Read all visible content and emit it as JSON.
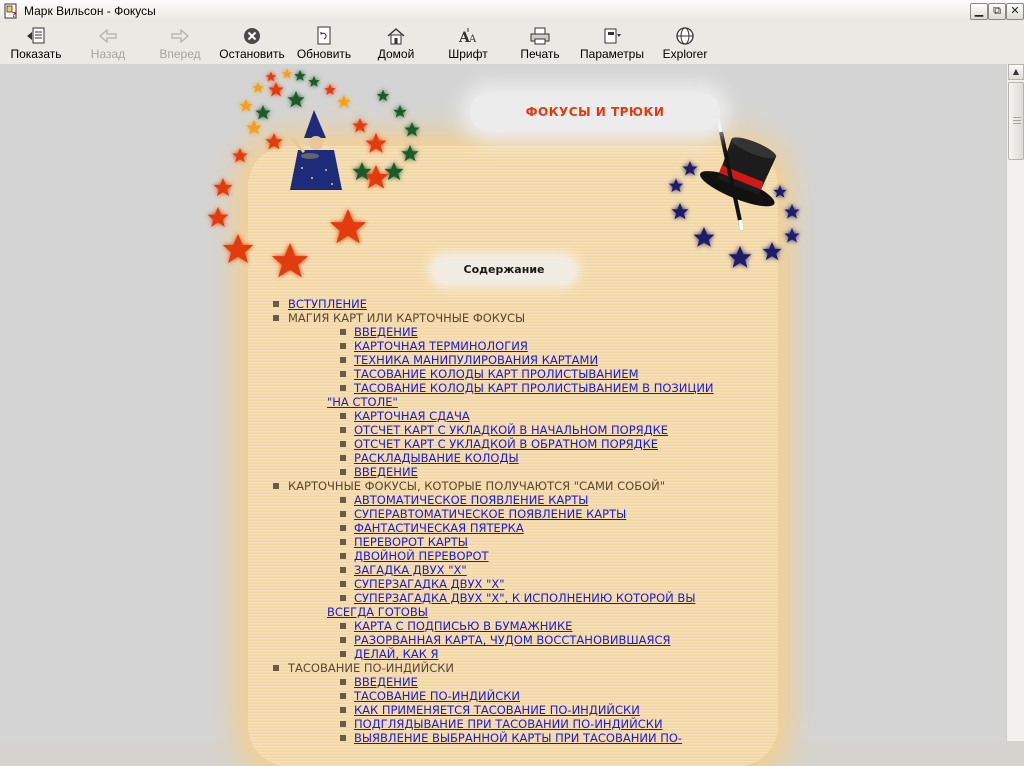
{
  "window": {
    "title": "Марк Вильсон - Фокусы"
  },
  "toolbar": {
    "buttons": [
      {
        "label": "Показать",
        "icon": "show-pane-icon",
        "enabled": true
      },
      {
        "label": "Назад",
        "icon": "back-arrow-icon",
        "enabled": false
      },
      {
        "label": "Вперед",
        "icon": "forward-arrow-icon",
        "enabled": false
      },
      {
        "label": "Остановить",
        "icon": "stop-icon",
        "enabled": true
      },
      {
        "label": "Обновить",
        "icon": "refresh-icon",
        "enabled": true
      },
      {
        "label": "Домой",
        "icon": "home-icon",
        "enabled": true
      },
      {
        "label": "Шрифт",
        "icon": "font-icon",
        "enabled": true
      },
      {
        "label": "Печать",
        "icon": "print-icon",
        "enabled": true
      },
      {
        "label": "Параметры",
        "icon": "options-icon",
        "enabled": true
      },
      {
        "label": "Explorer",
        "icon": "explorer-icon",
        "enabled": true
      }
    ]
  },
  "page": {
    "heading": "ФОКУСЫ И ТРЮКИ",
    "toc_title": "Содержание",
    "accent_color": "#e23a0f",
    "link_color": "#1a1ad0",
    "toc": [
      {
        "level": 1,
        "type": "link",
        "text": "ВСТУПЛЕНИЕ"
      },
      {
        "level": 1,
        "type": "plain",
        "text": "МАГИЯ КАРТ ИЛИ КАРТОЧНЫЕ ФОКУСЫ"
      },
      {
        "level": 2,
        "type": "link",
        "text": "ВВЕДЕНИЕ"
      },
      {
        "level": 2,
        "type": "link",
        "text": "КАРТОЧНАЯ ТЕРМИНОЛОГИЯ"
      },
      {
        "level": 2,
        "type": "link",
        "text": "ТЕХНИКА МАНИПУЛИРОВАНИЯ КАРТАМИ"
      },
      {
        "level": 2,
        "type": "link",
        "text": "ТАСОВАНИЕ КОЛОДЫ КАРТ ПРОЛИСТЫВАНИЕМ"
      },
      {
        "level": 2,
        "type": "link",
        "text": "ТАСОВАНИЕ КОЛОДЫ КАРТ ПРОЛИСТЫВАНИЕМ В ПОЗИЦИИ"
      },
      {
        "level": 2,
        "type": "link-cont",
        "text": "\"НА СТОЛЕ\""
      },
      {
        "level": 2,
        "type": "link",
        "text": "КАРТОЧНАЯ СДАЧА"
      },
      {
        "level": 2,
        "type": "link",
        "text": "ОТСЧЕТ КАРТ С УКЛАДКОЙ В НАЧАЛЬНОМ ПОРЯДКЕ"
      },
      {
        "level": 2,
        "type": "link",
        "text": "ОТСЧЕТ КАРТ С УКЛАДКОЙ В ОБРАТНОМ ПОРЯДКЕ"
      },
      {
        "level": 2,
        "type": "link",
        "text": "РАСКЛАДЫВАНИЕ КОЛОДЫ"
      },
      {
        "level": 2,
        "type": "link",
        "text": "ВВЕДЕНИЕ"
      },
      {
        "level": 1,
        "type": "plain",
        "text": "КАРТОЧНЫЕ ФОКУСЫ, КОТОРЫЕ ПОЛУЧАЮТСЯ \"САМИ СОБОЙ\""
      },
      {
        "level": 2,
        "type": "link",
        "text": "АВТОМАТИЧЕСКОЕ ПОЯВЛЕНИЕ КАРТЫ"
      },
      {
        "level": 2,
        "type": "link",
        "text": "СУПЕРАВТОМАТИЧЕСКОЕ ПОЯВЛЕНИЕ КАРТЫ"
      },
      {
        "level": 2,
        "type": "link",
        "text": "ФАНТАСТИЧЕСКАЯ ПЯТЕРКА"
      },
      {
        "level": 2,
        "type": "link",
        "text": "ПЕРЕВОРОТ КАРТЫ"
      },
      {
        "level": 2,
        "type": "link",
        "text": "ДВОЙНОЙ ПЕРЕВОРОТ"
      },
      {
        "level": 2,
        "type": "link",
        "text": "ЗАГАДКА ДВУХ \"Х\""
      },
      {
        "level": 2,
        "type": "link",
        "text": "СУПЕРЗАГАДКА ДВУХ \"Х\""
      },
      {
        "level": 2,
        "type": "link",
        "text": "СУПЕРЗАГАДКА  ДВУХ  \"Х\",  К  ИСПОЛНЕНИЮ  КОТОРОЙ  ВЫ"
      },
      {
        "level": 2,
        "type": "link-cont",
        "text": "ВСЕГДА ГОТОВЫ"
      },
      {
        "level": 2,
        "type": "link",
        "text": "КАРТА С ПОДПИСЬЮ В БУМАЖНИКЕ"
      },
      {
        "level": 2,
        "type": "link",
        "text": "РАЗОРВАННАЯ КАРТА, ЧУДОМ ВОССТАНОВИВШАЯСЯ"
      },
      {
        "level": 2,
        "type": "link",
        "text": "ДЕЛАЙ, КАК Я"
      },
      {
        "level": 1,
        "type": "plain",
        "text": "ТАСОВАНИЕ ПО-ИНДИЙСКИ"
      },
      {
        "level": 2,
        "type": "link",
        "text": "ВВЕДЕНИЕ"
      },
      {
        "level": 2,
        "type": "link",
        "text": "ТАСОВАНИЕ ПО-ИНДИЙСКИ"
      },
      {
        "level": 2,
        "type": "link",
        "text": "КАК ПРИМЕНЯЕТСЯ ТАСОВАНИЕ ПО-ИНДИЙСКИ"
      },
      {
        "level": 2,
        "type": "link",
        "text": "ПОДГЛЯДЫВАНИЕ ПРИ ТАСОВАНИИ ПО-ИНДИЙСКИ"
      },
      {
        "level": 2,
        "type": "link",
        "text": "ВЫЯВЛЕНИЕ  ВЫБРАННОЙ  КАРТЫ  ПРИ  ТАСОВАНИИ  ПО-"
      }
    ]
  }
}
